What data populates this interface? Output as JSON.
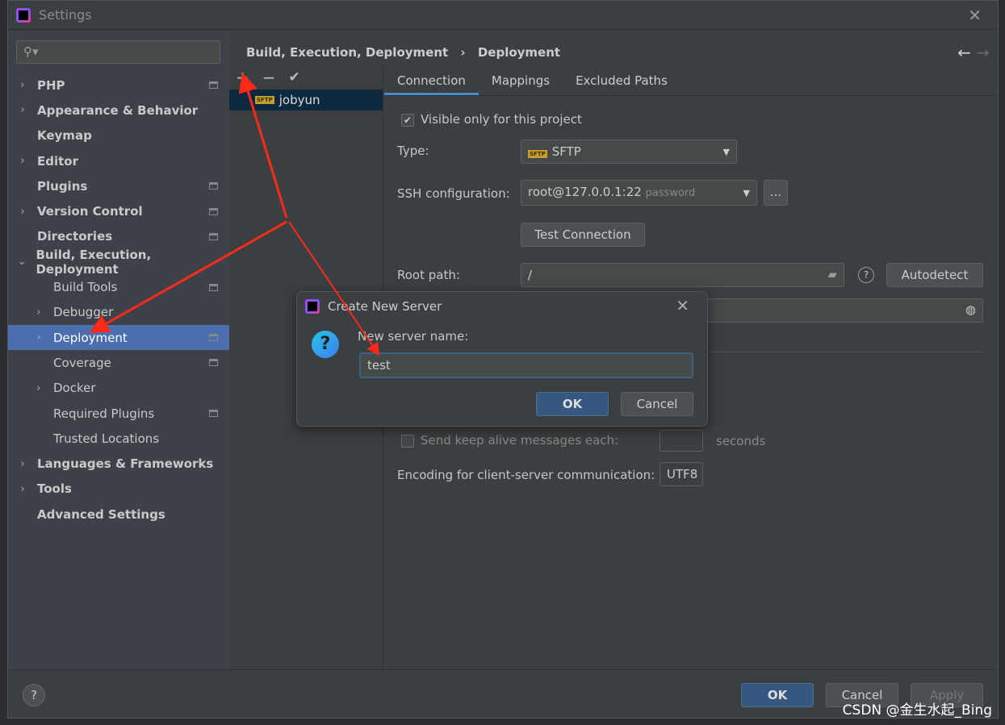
{
  "window": {
    "title": "Settings"
  },
  "search": {
    "placeholder": ""
  },
  "sidebar": {
    "items": [
      {
        "label": "PHP",
        "chev": "›",
        "pin": true
      },
      {
        "label": "Appearance & Behavior",
        "chev": "›"
      },
      {
        "label": "Keymap",
        "chev": ""
      },
      {
        "label": "Editor",
        "chev": "›"
      },
      {
        "label": "Plugins",
        "chev": "",
        "pin": true
      },
      {
        "label": "Version Control",
        "chev": "›",
        "pin": true
      },
      {
        "label": "Directories",
        "chev": "",
        "pin": true
      },
      {
        "label": "Build, Execution, Deployment",
        "chev": "⌄"
      },
      {
        "label": "Build Tools",
        "chev": "",
        "sub": true,
        "pin": true
      },
      {
        "label": "Debugger",
        "chev": "›",
        "sub": true
      },
      {
        "label": "Deployment",
        "chev": "›",
        "sub": true,
        "pin": true,
        "selected": true
      },
      {
        "label": "Coverage",
        "chev": "",
        "sub": true,
        "pin": true
      },
      {
        "label": "Docker",
        "chev": "›",
        "sub": true
      },
      {
        "label": "Required Plugins",
        "chev": "",
        "sub": true,
        "pin": true
      },
      {
        "label": "Trusted Locations",
        "chev": "",
        "sub": true
      },
      {
        "label": "Languages & Frameworks",
        "chev": "›"
      },
      {
        "label": "Tools",
        "chev": "›"
      },
      {
        "label": "Advanced Settings",
        "chev": ""
      }
    ]
  },
  "breadcrumb": {
    "parent": "Build, Execution, Deployment",
    "sep": "›",
    "current": "Deployment"
  },
  "toolbar": {
    "add": "+",
    "remove": "−",
    "check": "✔"
  },
  "servers": [
    {
      "name": "jobyun",
      "badge": "SFTP"
    }
  ],
  "tabs": [
    "Connection",
    "Mappings",
    "Excluded Paths"
  ],
  "connection": {
    "visible_only": "Visible only for this project",
    "type_label": "Type:",
    "type_value": "SFTP",
    "ssh_label": "SSH configuration:",
    "ssh_value": "root@127.0.0.1:22",
    "ssh_hint": "password",
    "ellipsis": "...",
    "test_button": "Test Connection",
    "root_label": "Root path:",
    "root_value": "/",
    "autodetect": "Autodetect",
    "keepalive": "Send keep alive messages each:",
    "seconds": "seconds",
    "encoding_label": "Encoding for client-server communication:",
    "encoding_value": "UTF8"
  },
  "footer": {
    "help": "?",
    "ok": "OK",
    "cancel": "Cancel",
    "apply": "Apply"
  },
  "dialog": {
    "title": "Create New Server",
    "label": "New server name:",
    "value": "test",
    "ok": "OK",
    "cancel": "Cancel"
  },
  "watermark": "CSDN @金生水起_Bing",
  "colors": {
    "accent": "#4b6eaf",
    "annotation_arrow": "#ff2a1a"
  }
}
